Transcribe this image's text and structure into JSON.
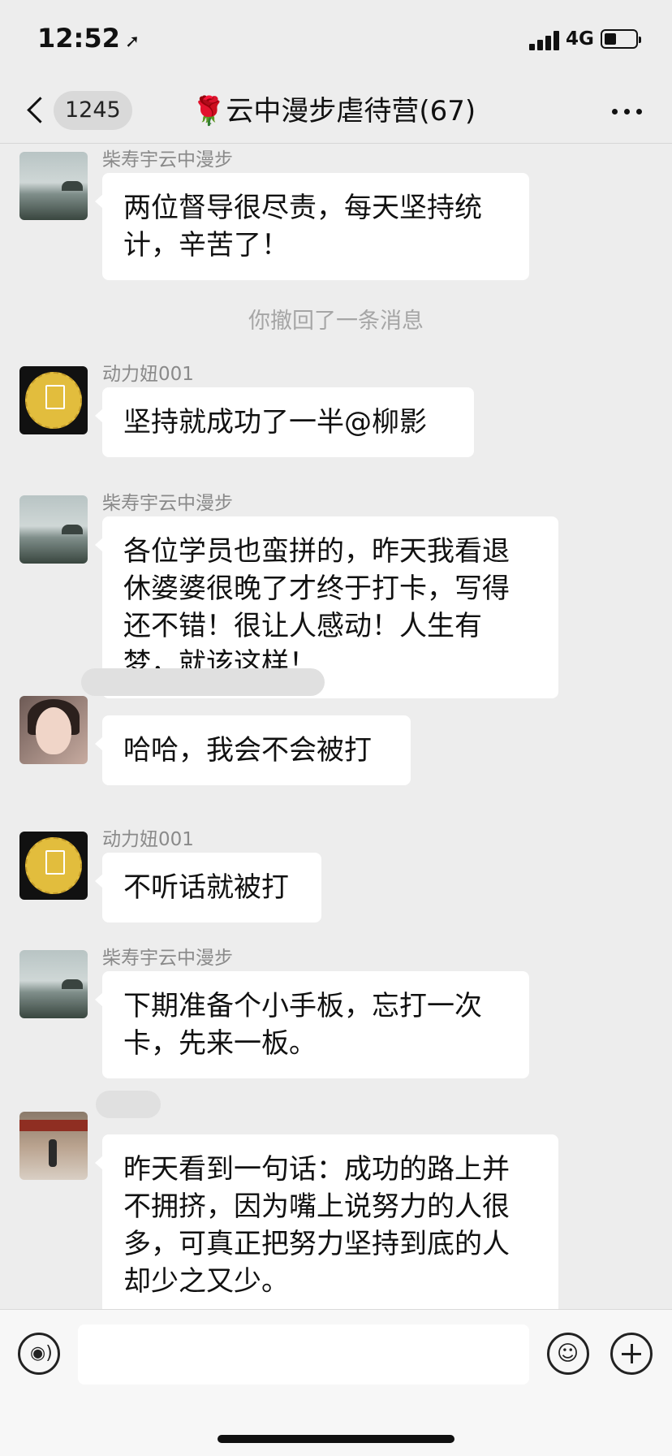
{
  "status_bar": {
    "time": "12:52",
    "network": "4G"
  },
  "nav": {
    "unread_count": "1245",
    "title": "🌹云中漫步虐待营(67)"
  },
  "messages": [
    {
      "sender": "柴寿宇云中漫步",
      "lines": [
        "两位督导很尽责，每天坚持统",
        "计，辛苦了！"
      ]
    },
    {
      "system": "你撤回了一条消息"
    },
    {
      "sender": "动力妞001",
      "lines": [
        "坚持就成功了一半@柳影"
      ]
    },
    {
      "sender": "柴寿宇云中漫步",
      "lines": [
        "各位学员也蛮拼的，昨天我看退",
        "休婆婆很晚了才终于打卡，写得",
        "还不错！很让人感动！人生有",
        "梦，就该这样！"
      ]
    },
    {
      "sender": "",
      "lines": [
        "哈哈，我会不会被打"
      ]
    },
    {
      "sender": "动力妞001",
      "lines": [
        "不听话就被打"
      ]
    },
    {
      "sender": "柴寿宇云中漫步",
      "lines": [
        "下期准备个小手板，忘打一次",
        "卡，先来一板。"
      ]
    },
    {
      "sender": "",
      "lines": [
        "昨天看到一句话：成功的路上并",
        "不拥挤，因为嘴上说努力的人很",
        "多，可真正把努力坚持到底的人",
        "却少之又少。"
      ]
    }
  ],
  "input_bar": {
    "text_value": ""
  }
}
